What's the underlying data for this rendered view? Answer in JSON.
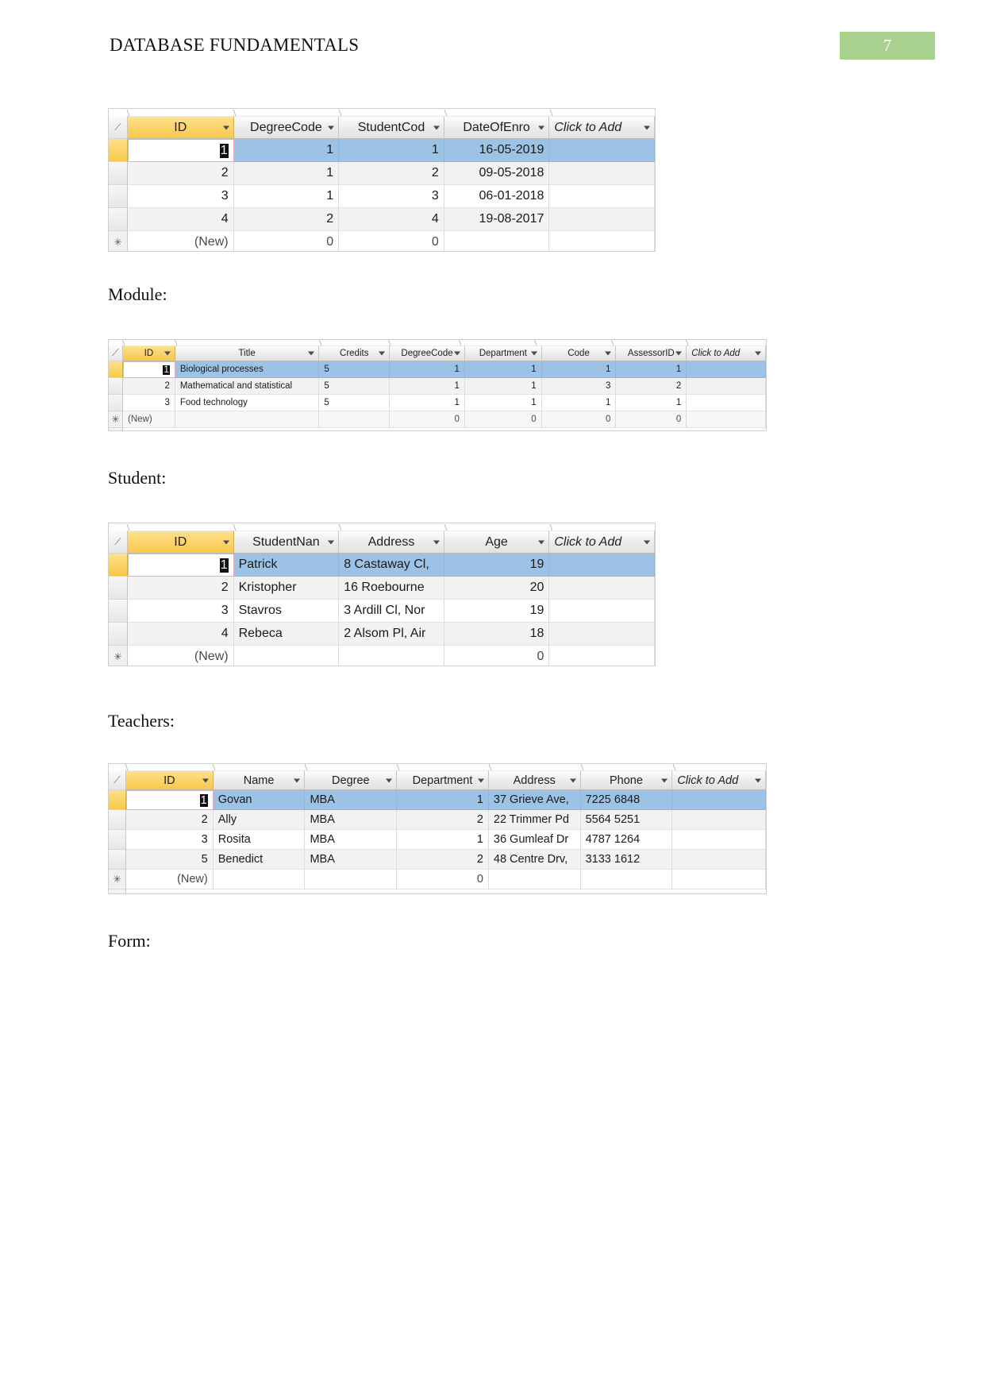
{
  "header": {
    "title": "DATABASE FUNDAMENTALS",
    "page_number": "7",
    "badge_color": "#a9d18e"
  },
  "captions": {
    "module": "Module:",
    "student": "Student:",
    "teachers": "Teachers:",
    "form": "Form:"
  },
  "common": {
    "click_to_add": "Click to Add",
    "new_row": "(New)",
    "new_marker": "✳"
  },
  "tables": {
    "enrollment": {
      "columns": [
        "ID",
        "DegreeCode",
        "StudentCod",
        "DateOfEnro",
        "Click to Add"
      ],
      "rows": [
        {
          "id": "1",
          "degree_code": "1",
          "student_code": "1",
          "date_of_enrolment": "16-05-2019",
          "add": ""
        },
        {
          "id": "2",
          "degree_code": "1",
          "student_code": "2",
          "date_of_enrolment": "09-05-2018",
          "add": ""
        },
        {
          "id": "3",
          "degree_code": "1",
          "student_code": "3",
          "date_of_enrolment": "06-01-2018",
          "add": ""
        },
        {
          "id": "4",
          "degree_code": "2",
          "student_code": "4",
          "date_of_enrolment": "19-08-2017",
          "add": ""
        }
      ],
      "new_row": {
        "id": "(New)",
        "degree_code": "0",
        "student_code": "0",
        "date_of_enrolment": "",
        "add": ""
      }
    },
    "module": {
      "columns": [
        "ID",
        "Title",
        "Credits",
        "DegreeCode",
        "Department",
        "Code",
        "AssessorID",
        "Click to Add"
      ],
      "rows": [
        {
          "id": "1",
          "title": "Biological processes",
          "credits": "5",
          "degree_code": "1",
          "department": "1",
          "code": "1",
          "assessor_id": "1",
          "add": ""
        },
        {
          "id": "2",
          "title": "Mathematical and statistical",
          "credits": "5",
          "degree_code": "1",
          "department": "1",
          "code": "3",
          "assessor_id": "2",
          "add": ""
        },
        {
          "id": "3",
          "title": "Food technology",
          "credits": "5",
          "degree_code": "1",
          "department": "1",
          "code": "1",
          "assessor_id": "1",
          "add": ""
        }
      ],
      "new_row": {
        "id": "(New)",
        "title": "",
        "credits": "",
        "degree_code": "0",
        "department": "0",
        "code": "0",
        "assessor_id": "0",
        "add": ""
      }
    },
    "student": {
      "columns": [
        "ID",
        "StudentNan",
        "Address",
        "Age",
        "Click to Add"
      ],
      "rows": [
        {
          "id": "1",
          "name": "Patrick",
          "address": "8 Castaway Cl,",
          "age": "19",
          "add": ""
        },
        {
          "id": "2",
          "name": "Kristopher",
          "address": "16 Roebourne",
          "age": "20",
          "add": ""
        },
        {
          "id": "3",
          "name": "Stavros",
          "address": "3 Ardill Cl, Nor",
          "age": "19",
          "add": ""
        },
        {
          "id": "4",
          "name": "Rebeca",
          "address": "2 Alsom Pl, Air",
          "age": "18",
          "add": ""
        }
      ],
      "new_row": {
        "id": "(New)",
        "name": "",
        "address": "",
        "age": "0",
        "add": ""
      }
    },
    "teachers": {
      "columns": [
        "ID",
        "Name",
        "Degree",
        "Department",
        "Address",
        "Phone",
        "Click to Add"
      ],
      "rows": [
        {
          "id": "1",
          "name": "Govan",
          "degree": "MBA",
          "department": "1",
          "address": "37 Grieve Ave,",
          "phone": "7225 6848",
          "add": ""
        },
        {
          "id": "2",
          "name": "Ally",
          "degree": "MBA",
          "department": "2",
          "address": "22 Trimmer Pd",
          "phone": "5564 5251",
          "add": ""
        },
        {
          "id": "3",
          "name": "Rosita",
          "degree": "MBA",
          "department": "1",
          "address": "36 Gumleaf Dr",
          "phone": "4787 1264",
          "add": ""
        },
        {
          "id": "5",
          "name": "Benedict",
          "degree": "MBA",
          "department": "2",
          "address": "48 Centre Drv,",
          "phone": "3133 1612",
          "add": ""
        }
      ],
      "new_row": {
        "id": "(New)",
        "name": "",
        "degree": "",
        "department": "0",
        "address": "",
        "phone": "",
        "add": ""
      }
    }
  }
}
